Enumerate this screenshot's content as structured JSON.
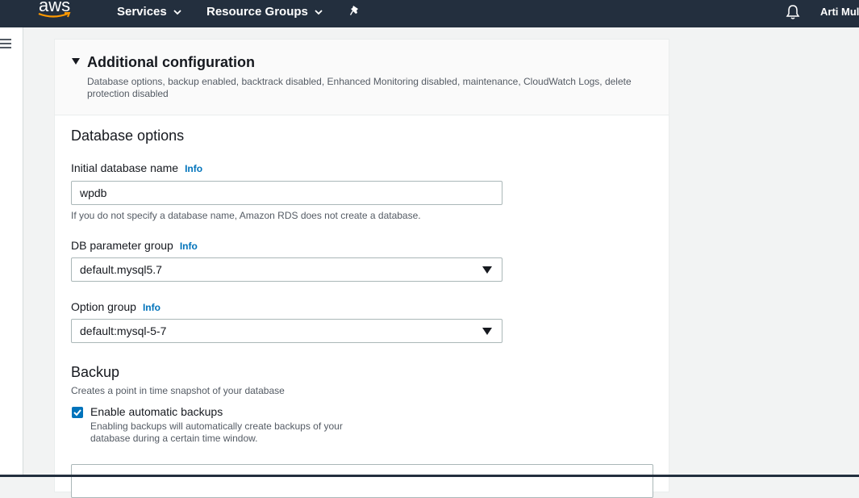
{
  "nav": {
    "logo_text": "aws",
    "services_label": "Services",
    "resource_groups_label": "Resource Groups",
    "user_name": "Arti Mul"
  },
  "icons": {
    "menu": "hamburger-icon",
    "pin": "pin-icon",
    "notifications": "bell-icon",
    "dropdown": "caret-down-icon",
    "expand": "caret-down-icon",
    "checkbox": "checkmark-icon"
  },
  "colors": {
    "nav_bg": "#232f3e",
    "link": "#0073bb",
    "checkbox": "#0073bb"
  },
  "panel": {
    "title": "Additional configuration",
    "description": "Database options, backup enabled, backtrack disabled, Enhanced Monitoring disabled, maintenance, CloudWatch Logs, delete protection disabled"
  },
  "database_options": {
    "title": "Database options",
    "initial_db_name": {
      "label": "Initial database name",
      "info": "Info",
      "value": "wpdb",
      "hint": "If you do not specify a database name, Amazon RDS does not create a database."
    },
    "parameter_group": {
      "label": "DB parameter group",
      "info": "Info",
      "value": "default.mysql5.7"
    },
    "option_group": {
      "label": "Option group",
      "info": "Info",
      "value": "default:mysql-5-7"
    }
  },
  "backup": {
    "title": "Backup",
    "description": "Creates a point in time snapshot of your database",
    "enable_label": "Enable automatic backups",
    "enable_checked": true,
    "enable_description": "Enabling backups will automatically create backups of your database during a certain time window."
  }
}
